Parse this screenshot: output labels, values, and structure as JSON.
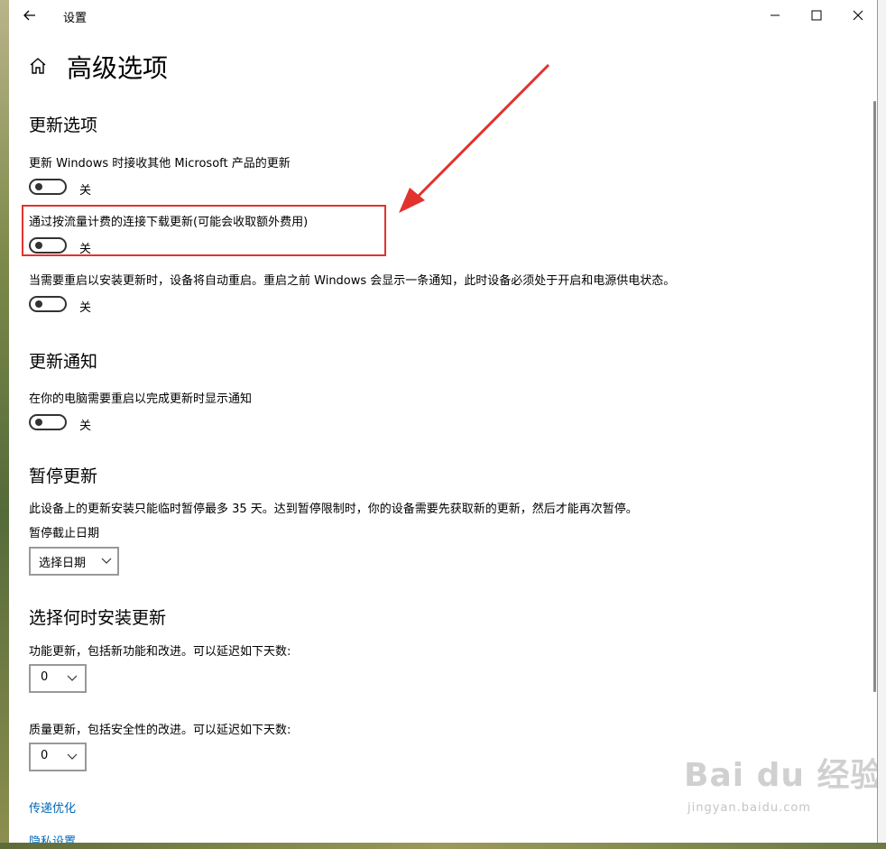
{
  "window": {
    "title": "设置",
    "page_title": "高级选项"
  },
  "update_options": {
    "heading": "更新选项",
    "other_products_label": "更新 Windows 时接收其他 Microsoft 产品的更新",
    "other_products_state": "关",
    "metered_label": "通过按流量计费的连接下载更新(可能会收取额外费用)",
    "metered_state": "关",
    "restart_label": "当需要重启以安装更新时，设备将自动重启。重启之前 Windows 会显示一条通知，此时设备必须处于开启和电源供电状态。",
    "restart_state": "关"
  },
  "update_notifications": {
    "heading": "更新通知",
    "notify_label": "在你的电脑需要重启以完成更新时显示通知",
    "notify_state": "关"
  },
  "pause_updates": {
    "heading": "暂停更新",
    "description": "此设备上的更新安装只能临时暂停最多 35 天。达到暂停限制时，你的设备需要先获取新的更新，然后才能再次暂停。",
    "deadline_label": "暂停截止日期",
    "date_select": "选择日期"
  },
  "install_timing": {
    "heading": "选择何时安装更新",
    "feature_label": "功能更新，包括新功能和改进。可以延迟如下天数:",
    "feature_value": "0",
    "quality_label": "质量更新，包括安全性的改进。可以延迟如下天数:",
    "quality_value": "0"
  },
  "links": {
    "delivery": "传递优化",
    "privacy": "隐私设置"
  },
  "watermark": {
    "logo": "Bai du 经验",
    "url": "jingyan.baidu.com"
  },
  "colors": {
    "highlight": "#e2322e",
    "link": "#0067b8"
  },
  "icons": [
    "back-arrow-icon",
    "minimize-icon",
    "maximize-icon",
    "close-icon",
    "home-icon",
    "chevron-down-icon"
  ]
}
